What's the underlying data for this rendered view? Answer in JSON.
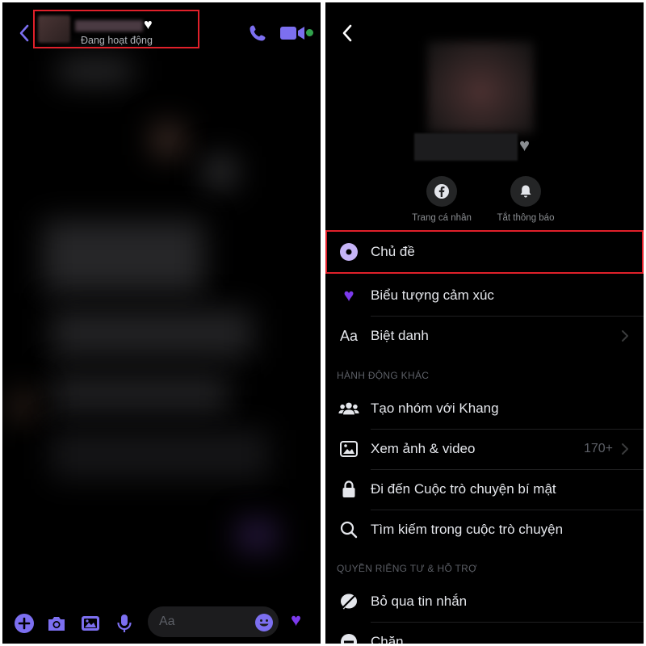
{
  "chat": {
    "header": {
      "status": "Đang hoạt động"
    },
    "composer": {
      "input_placeholder": "Aa"
    }
  },
  "settings": {
    "quick_actions": [
      {
        "label": "Trang cá nhân",
        "icon": "facebook-icon"
      },
      {
        "label": "Tắt thông báo",
        "icon": "bell-icon"
      }
    ],
    "menu_top": [
      {
        "label": "Chủ đề",
        "icon": "theme-circle-icon"
      },
      {
        "label": "Biểu tượng cảm xúc",
        "icon": "purple-heart-icon"
      },
      {
        "label": "Biệt danh",
        "icon": "aa-icon",
        "icon_text": "Aa"
      }
    ],
    "section_more": "HÀNH ĐỘNG KHÁC",
    "menu_more": [
      {
        "label": "Tạo nhóm với Khang",
        "icon": "group-icon"
      },
      {
        "label": "Xem ảnh & video",
        "icon": "image-icon",
        "value": "170+"
      },
      {
        "label": "Đi đến Cuộc trò chuyện bí mật",
        "icon": "lock-icon"
      },
      {
        "label": "Tìm kiếm trong cuộc trò chuyện",
        "icon": "search-icon"
      }
    ],
    "section_privacy": "QUYỀN RIÊNG TƯ & HỖ TRỢ",
    "menu_privacy": [
      {
        "label": "Bỏ qua tin nhắn",
        "icon": "ignore-icon"
      },
      {
        "label": "Chặn",
        "icon": "block-icon"
      }
    ]
  },
  "colors": {
    "accent_purple": "#7c3aed",
    "theme_circle": "#c6b4f7",
    "highlight_red": "#e0202a",
    "online_green": "#31a24c"
  }
}
